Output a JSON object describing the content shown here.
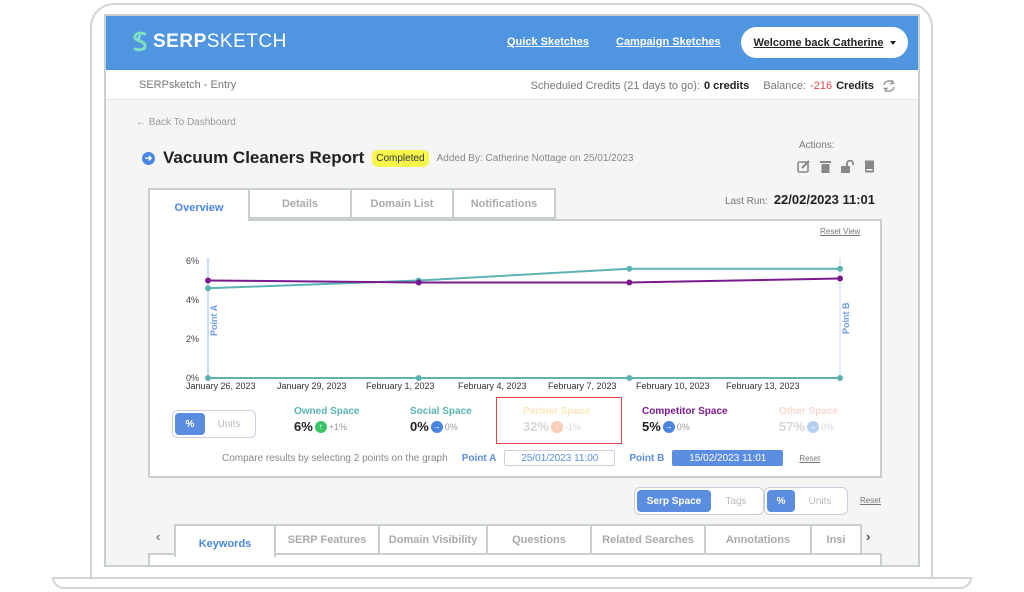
{
  "header": {
    "logo_bold": "SERP",
    "logo_light": "SKETCH",
    "nav": [
      "Quick Sketches",
      "Campaign Sketches"
    ],
    "welcome": "Welcome back Catherine"
  },
  "subbar": {
    "breadcrumb": "SERPsketch - Entry",
    "scheduled_label": "Scheduled Credits (21 days to go):",
    "scheduled_value": "0 credits",
    "balance_label": "Balance:",
    "balance_value": "-216",
    "balance_unit": "Credits"
  },
  "page": {
    "back": "Back To Dashboard",
    "title": "Vacuum Cleaners Report",
    "status": "Completed",
    "added_by": "Added By: Catherine Nottage on 25/01/2023",
    "actions_label": "Actions:",
    "actions": [
      "edit-icon",
      "trash-icon",
      "unlock-icon",
      "book-icon"
    ],
    "last_run_label": "Last Run:",
    "last_run_value": "22/02/2023 11:01"
  },
  "tabs": [
    "Overview",
    "Details",
    "Domain List",
    "Notifications"
  ],
  "active_tab": "Overview",
  "reset_view": "Reset View",
  "chart_data": {
    "type": "line",
    "y_ticks": [
      "0%",
      "2%",
      "4%",
      "6%"
    ],
    "ylim": [
      0,
      6
    ],
    "x_ticks": [
      "January 26, 2023",
      "January 29, 2023",
      "February 1, 2023",
      "February 4, 2023",
      "February 7, 2023",
      "February 10, 2023",
      "February 13, 2023"
    ],
    "point_a_label": "Point A",
    "point_b_label": "Point B",
    "series": [
      {
        "name": "Owned Space",
        "color": "#5bb3b3",
        "values": [
          4.6,
          5.0,
          5.6,
          5.6
        ]
      },
      {
        "name": "Competitor Space",
        "color": "#7b1a8f",
        "values": [
          5.0,
          4.9,
          4.9,
          5.1
        ]
      },
      {
        "name": "Social Space",
        "color": "#5bb3b3",
        "values": [
          0,
          0,
          0,
          0
        ]
      }
    ]
  },
  "view_toggle": {
    "options": [
      "%",
      "Units"
    ],
    "selected": "%"
  },
  "metrics": [
    {
      "label": "Owned Space",
      "value": "6%",
      "delta": "+1%",
      "trend": "up",
      "color": "#5bb3b3",
      "icon_color": "#3cc46a"
    },
    {
      "label": "Social Space",
      "value": "0%",
      "delta": "0%",
      "trend": "flat",
      "color": "#5bb3b3",
      "icon_color": "#4a86e0"
    },
    {
      "label": "Partner Space",
      "value": "32%",
      "delta": "-1%",
      "trend": "down",
      "color": "#f5c75a",
      "icon_color": "#f08a4b"
    },
    {
      "label": "Competitor Space",
      "value": "5%",
      "delta": "0%",
      "trend": "flat",
      "color": "#7b1a8f",
      "icon_color": "#4a86e0"
    },
    {
      "label": "Other Space",
      "value": "57%",
      "delta": "0%",
      "trend": "flat",
      "color": "#f0a08a",
      "icon_color": "#4a86e0"
    }
  ],
  "compare": {
    "text": "Compare results by selecting 2 points on the graph",
    "point_a_label": "Point A",
    "point_a_value": "25/01/2023 11:00",
    "point_b_label": "Point B",
    "point_b_value": "15/02/2023 11:01",
    "reset": "Reset"
  },
  "space_toggle": {
    "options": [
      "Serp Space",
      "Tags"
    ],
    "selected": "Serp Space"
  },
  "unit_toggle": {
    "options": [
      "%",
      "Units"
    ],
    "selected": "%"
  },
  "reset2": "Reset",
  "bottom_tabs": [
    "Keywords",
    "SERP Features",
    "Domain Visibility",
    "Questions",
    "Related Searches",
    "Annotations",
    "Insi"
  ],
  "active_bottom_tab": "Keywords"
}
